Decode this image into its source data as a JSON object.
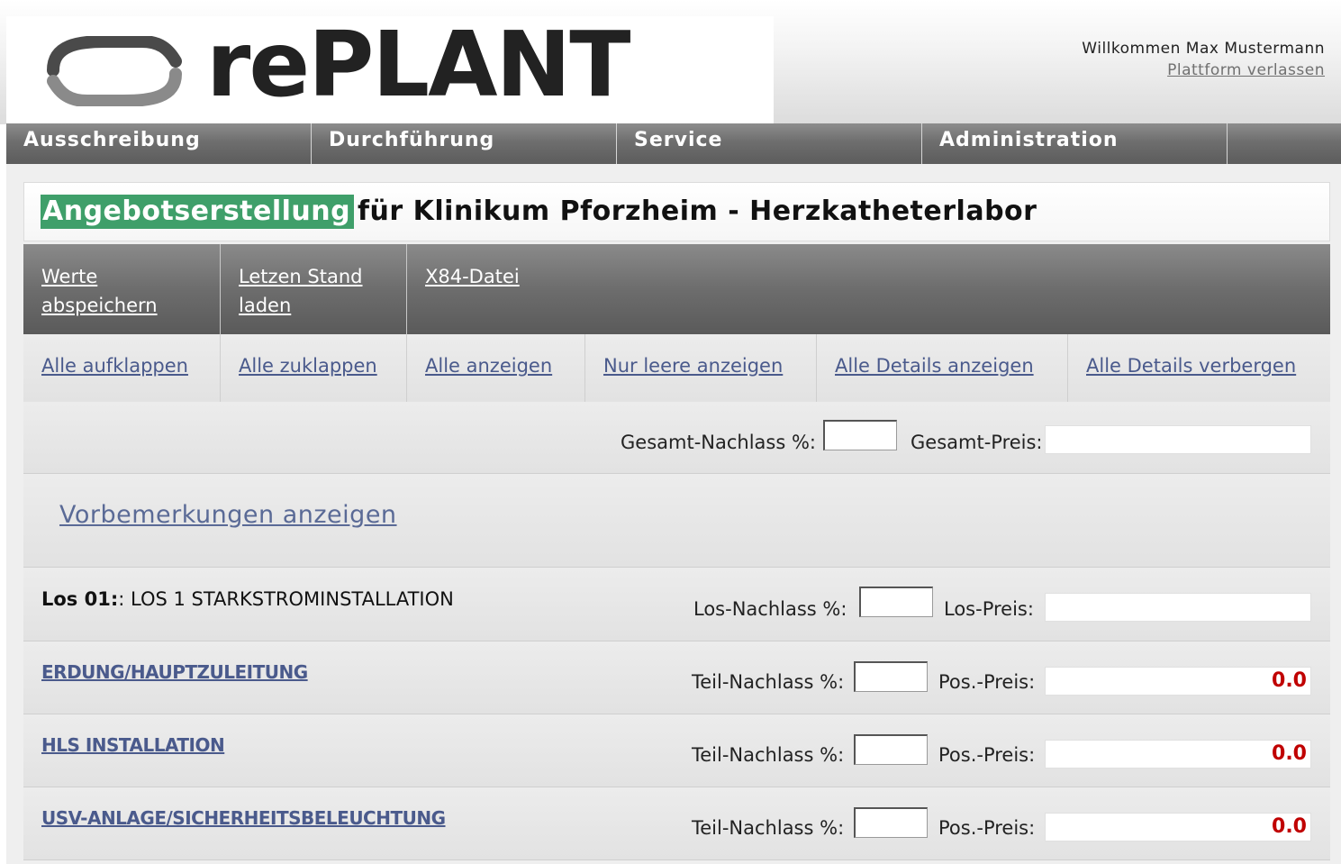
{
  "header": {
    "logo_text": "rePLANT",
    "welcome": "Willkommen Max Mustermann",
    "leave_link": "Plattform verlassen"
  },
  "nav": {
    "items": [
      {
        "label": "Ausschreibung"
      },
      {
        "label": "Durchführung"
      },
      {
        "label": "Service"
      },
      {
        "label": "Administration"
      }
    ]
  },
  "page": {
    "title_highlight": "Angebotserstellung",
    "title_rest": "für Klinikum Pforzheim - Herzkatheterlabor"
  },
  "toolbar_primary": [
    {
      "label": "Werte abspeichern"
    },
    {
      "label": "Letzen Stand laden"
    },
    {
      "label": "X84-Datei"
    }
  ],
  "toolbar_secondary": [
    {
      "label": "Alle aufklappen"
    },
    {
      "label": "Alle zuklappen"
    },
    {
      "label": "Alle anzeigen"
    },
    {
      "label": "Nur leere anzeigen"
    },
    {
      "label": "Alle Details anzeigen"
    },
    {
      "label": "Alle Details verbergen"
    }
  ],
  "totals": {
    "discount_label": "Gesamt-Nachlass %:",
    "discount_value": "",
    "price_label": "Gesamt-Preis:",
    "price_value": ""
  },
  "remarks_link": "Vorbemerkungen anzeigen",
  "los": {
    "number": "Los 01:",
    "name": ": LOS 1 STARKSTROMINSTALLATION",
    "discount_label": "Los-Nachlass %:",
    "discount_value": "",
    "price_label": "Los-Preis:",
    "price_value": ""
  },
  "positions": [
    {
      "name": "ERDUNG/HAUPTZULEITUNG",
      "discount_label": "Teil-Nachlass %:",
      "discount_value": "",
      "price_label": "Pos.-Preis:",
      "price_value": "0.0"
    },
    {
      "name": "HLS INSTALLATION",
      "discount_label": "Teil-Nachlass %:",
      "discount_value": "",
      "price_label": "Pos.-Preis:",
      "price_value": "0.0"
    },
    {
      "name": "USV-ANLAGE/SICHERHEITSBELEUCHTUNG",
      "discount_label": "Teil-Nachlass %:",
      "discount_value": "",
      "price_label": "Pos.-Preis:",
      "price_value": "0.0"
    }
  ]
}
